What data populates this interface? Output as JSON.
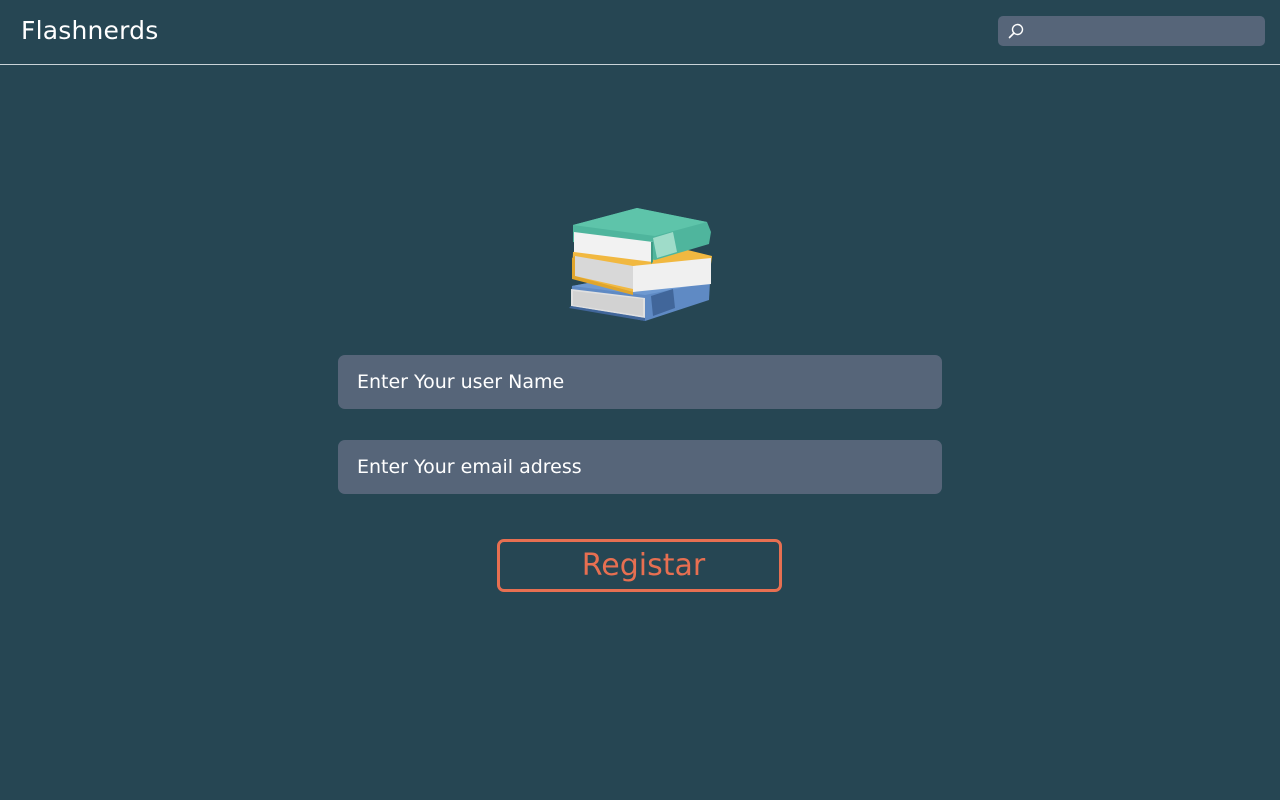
{
  "header": {
    "brand": "Flashnerds",
    "search": {
      "placeholder": "",
      "icon": "search-icon"
    }
  },
  "main": {
    "illustration": "books-stack-icon",
    "username_field": {
      "placeholder": "Enter Your user Name",
      "value": ""
    },
    "email_field": {
      "placeholder": "Enter Your email adress",
      "value": ""
    },
    "register_button": {
      "label": "Registar"
    }
  },
  "colors": {
    "background": "#264653",
    "field": "#566579",
    "accent": "#e76f51",
    "text": "#ffffff"
  }
}
